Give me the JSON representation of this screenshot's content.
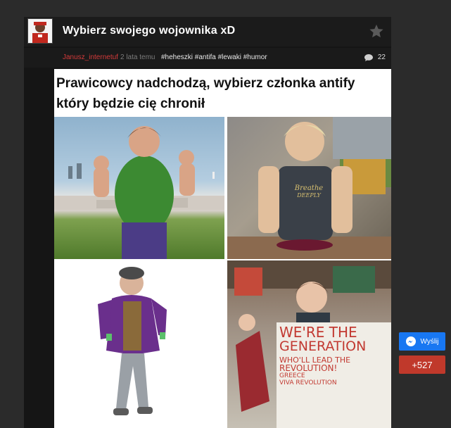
{
  "post": {
    "title": "Wybierz swojego wojownika xD",
    "author": "Janusz_internetuf",
    "time": "2 lata temu",
    "tags": "#heheszki #antifa #lewaki #humor",
    "comments_count": "22",
    "icons": {
      "star": "star-icon",
      "comment": "comment-icon",
      "avatar": "avatar"
    }
  },
  "meme": {
    "caption_line1": "Prawicowcy nadchodzą, wybierz członka antify",
    "caption_line2": "który będzie cię chronił",
    "shirt_text_1": "Breathe",
    "shirt_text_2": "DEEPLY",
    "sign_line1": "WE'RE THE",
    "sign_line2": "GENERATION",
    "sign_line3": "WHO'LL LEAD THE",
    "sign_line4": "REVOLUTION!",
    "sign_line5": "GREECE",
    "sign_line6": "VIVA REVOLUTION"
  },
  "side": {
    "share_label": "Wyślij",
    "score_label": "+527",
    "colors": {
      "messenger": "#1877f2",
      "score": "#c0392b"
    }
  }
}
